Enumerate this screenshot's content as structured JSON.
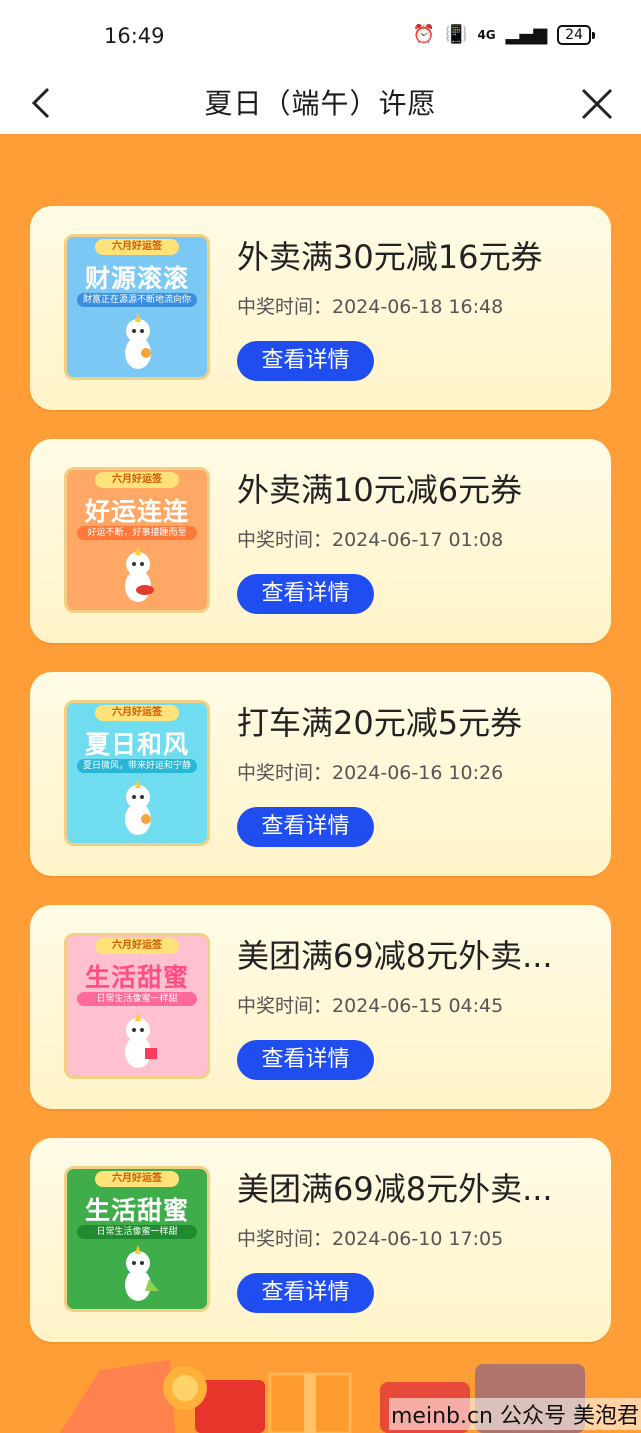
{
  "status_bar": {
    "time": "16:49",
    "network": "4G",
    "battery": "24"
  },
  "nav": {
    "title": "夏日（端午）许愿"
  },
  "cards": [
    {
      "title": "外卖满30元减16元券",
      "time": "中奖时间：2024-06-18 16:48",
      "button": "查看详情",
      "thumb": {
        "tag": "六月好运签",
        "title": "财源滚滚",
        "subtitle": "财富正在源源不断地流向你",
        "bg": "#7cc8f5",
        "title_color": "#ffffff",
        "sub_bg": "#3a8fe0"
      }
    },
    {
      "title": "外卖满10元减6元券",
      "time": "中奖时间：2024-06-17 01:08",
      "button": "查看详情",
      "thumb": {
        "tag": "六月好运签",
        "title": "好运连连",
        "subtitle": "好运不断，好事接踵而至",
        "bg": "#ffa866",
        "title_color": "#ffffff",
        "sub_bg": "#ff7a3a"
      }
    },
    {
      "title": "打车满20元减5元券",
      "time": "中奖时间：2024-06-16 10:26",
      "button": "查看详情",
      "thumb": {
        "tag": "六月好运签",
        "title": "夏日和风",
        "subtitle": "夏日微风，带来好运和宁静",
        "bg": "#6fdcef",
        "title_color": "#ffffff",
        "sub_bg": "#29b7d8"
      }
    },
    {
      "title": "美团满69减8元外卖...",
      "time": "中奖时间：2024-06-15 04:45",
      "button": "查看详情",
      "thumb": {
        "tag": "六月好运签",
        "title": "生活甜蜜",
        "subtitle": "日常生活像蜜一样甜",
        "bg": "#ffc0d0",
        "title_color": "#ff4f86",
        "sub_bg": "#ff6a9a"
      }
    },
    {
      "title": "美团满69减8元外卖...",
      "time": "中奖时间：2024-06-10 17:05",
      "button": "查看详情",
      "thumb": {
        "tag": "六月好运签",
        "title": "生活甜蜜",
        "subtitle": "日常生活像蜜一样甜",
        "bg": "#3fae4a",
        "title_color": "#ffffff",
        "sub_bg": "#1f8a2e"
      }
    }
  ],
  "watermark": "meinb.cn 公众号 美泡君"
}
